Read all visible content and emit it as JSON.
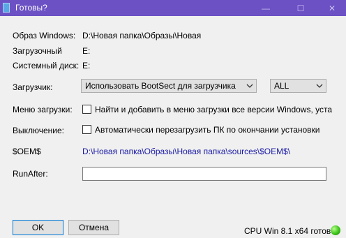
{
  "window": {
    "title": "Готовы?",
    "minimize_glyph": "—",
    "maximize_glyph": "☐",
    "close_glyph": "✕"
  },
  "info": {
    "image_label": "Образ Windows:",
    "image_value": "D:\\Новая папка\\Образы\\Новая",
    "boot_label": "Загрузочный",
    "boot_value": "E:",
    "system_label": "Системный диск:",
    "system_value": "E:"
  },
  "bootloader": {
    "label": "Загрузчик:",
    "selected": "Использовать BootSect для загрузчика",
    "target_selected": "ALL"
  },
  "boot_menu": {
    "label": "Меню загрузки:",
    "checkbox_label": "Найти и добавить в меню загрузки все версии Windows, уста",
    "checked": false
  },
  "shutdown": {
    "label": "Выключение:",
    "checkbox_label": "Автоматически перезагрузить ПК по окончании установки",
    "checked": false
  },
  "oem": {
    "label": "$OEM$",
    "path": "D:\\Новая папка\\Образы\\Новая папка\\sources\\$OEM$\\"
  },
  "runafter": {
    "label": "RunAfter:",
    "value": ""
  },
  "buttons": {
    "ok": "OK",
    "cancel": "Отмена"
  },
  "status": {
    "text": "CPU Win 8.1 x64 готов",
    "led_color": "#3cc41a"
  },
  "colors": {
    "titlebar": "#6b51c4",
    "link": "#1a1aa6"
  }
}
